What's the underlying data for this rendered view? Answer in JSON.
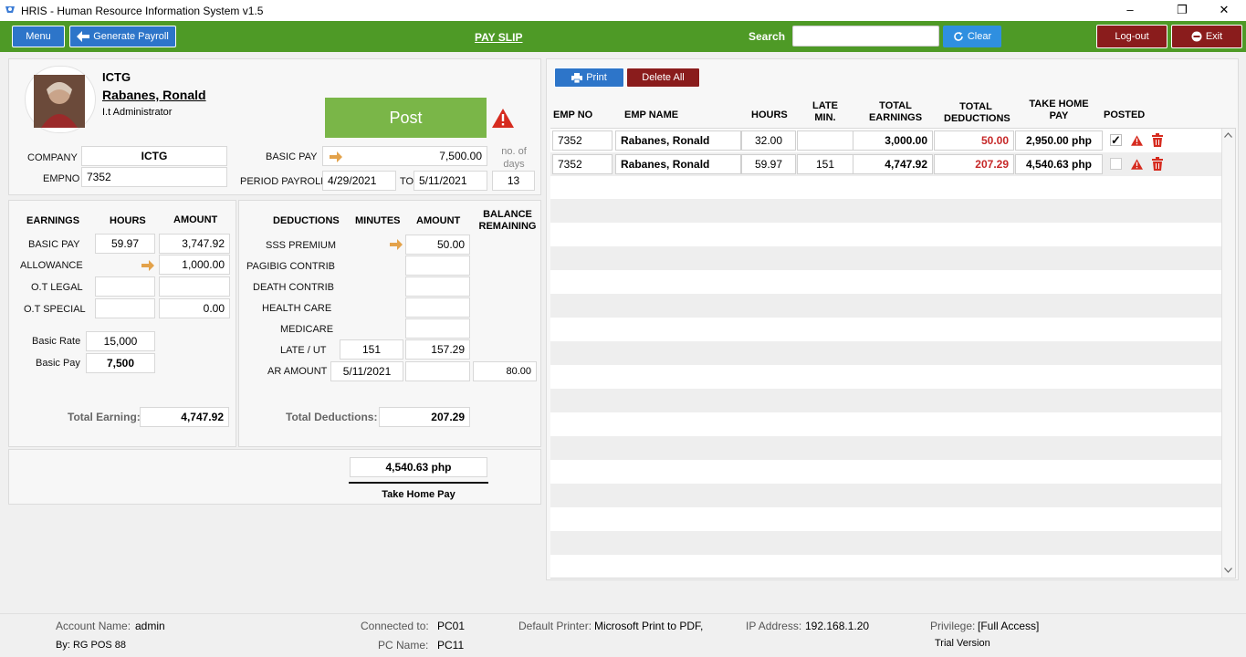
{
  "window": {
    "title": "HRIS - Human Resource Information System v1.5",
    "minimize": "–",
    "restore": "❐",
    "close": "✕"
  },
  "toolbar": {
    "menu": "Menu",
    "generate_payroll": "Generate Payroll",
    "page_title": "PAY SLIP",
    "search_label": "Search",
    "search_value": "",
    "clear": "Clear",
    "logout": "Log-out",
    "exit": "Exit",
    "accent": "#4e9a26"
  },
  "employee": {
    "company_short": "ICTG",
    "name": "Rabanes,  Ronald",
    "position": "I.t Administrator",
    "company_label": "COMPANY",
    "company": "ICTG",
    "empno_label": "EMPNO",
    "empno": "7352",
    "basic_pay_label": "BASIC PAY",
    "basic_pay": "7,500.00",
    "no_days_label": "no. of days",
    "period_label": "PERIOD PAYROLL",
    "period_from": "4/29/2021",
    "to_label": "TO",
    "period_to": "5/11/2021",
    "no_days": "13",
    "post": "Post"
  },
  "earnings": {
    "h_earnings": "EARNINGS",
    "h_hours": "HOURS",
    "h_amount": "AMOUNT",
    "rows": [
      {
        "label": "BASIC PAY",
        "hours": "59.97",
        "amount": "3,747.92"
      },
      {
        "label": "ALLOWANCE",
        "hours": "",
        "amount": "1,000.00"
      },
      {
        "label": "O.T LEGAL",
        "hours": "",
        "amount": ""
      },
      {
        "label": "O.T SPECIAL",
        "hours": "",
        "amount": "0.00"
      }
    ],
    "basic_rate_label": "Basic Rate",
    "basic_rate": "15,000",
    "basic_pay_label": "Basic Pay",
    "basic_pay": "7,500",
    "total_label": "Total Earning:",
    "total": "4,747.92"
  },
  "deductions": {
    "h_deductions": "DEDUCTIONS",
    "h_minutes": "MINUTES",
    "h_amount": "AMOUNT",
    "h_balance": "BALANCE REMAINING",
    "rows": [
      {
        "label": "SSS PREMIUM",
        "minutes": "",
        "amount": "50.00",
        "balance": ""
      },
      {
        "label": "PAGIBIG CONTRIB",
        "minutes": "",
        "amount": "",
        "balance": ""
      },
      {
        "label": "DEATH CONTRIB",
        "minutes": "",
        "amount": "",
        "balance": ""
      },
      {
        "label": "HEALTH CARE",
        "minutes": "",
        "amount": "",
        "balance": ""
      },
      {
        "label": "MEDICARE",
        "minutes": "",
        "amount": "",
        "balance": ""
      },
      {
        "label": "LATE /  UT",
        "minutes": "151",
        "amount": "157.29",
        "balance": ""
      },
      {
        "label": "AR AMOUNT",
        "minutes": "5/11/2021",
        "amount": "",
        "balance": "80.00"
      }
    ],
    "total_label": "Total Deductions:",
    "total": "207.29"
  },
  "take_home": {
    "value": "4,540.63 php",
    "label": "Take Home Pay"
  },
  "right": {
    "print": "Print",
    "delete_all": "Delete All",
    "headers": {
      "empno": "EMP NO",
      "name": "EMP NAME",
      "hours": "HOURS",
      "late": "LATE MIN.",
      "earn": "TOTAL EARNINGS",
      "ded": "TOTAL DEDUCTIONS",
      "thp": "TAKE HOME PAY",
      "posted": "POSTED"
    },
    "rows": [
      {
        "empno": "7352",
        "name": "Rabanes,  Ronald",
        "hours": "32.00",
        "late": "",
        "earn": "3,000.00",
        "ded": "50.00",
        "thp": "2,950.00 php",
        "posted": true
      },
      {
        "empno": "7352",
        "name": "Rabanes,  Ronald",
        "hours": "59.97",
        "late": "151",
        "earn": "4,747.92",
        "ded": "207.29",
        "thp": "4,540.63 php",
        "posted": false
      }
    ]
  },
  "footer": {
    "account_label": "Account Name:",
    "account": "admin",
    "by": "By: RG POS 88",
    "connected_label": "Connected to:",
    "connected": "PC01",
    "pcname_label": "PC Name:",
    "pcname": "PC11",
    "printer_label": "Default Printer:",
    "printer": "Microsoft Print to PDF,",
    "ip_label": "IP Address:",
    "ip": "192.168.1.20",
    "priv_label": "Privilege:",
    "priv": "[Full Access]",
    "trial": "Trial Version"
  },
  "colors": {
    "blue_button": "#2d75c9",
    "dark_red_button": "#8a1c1c",
    "post_green": "#7ab648",
    "deduction_red": "#c62828",
    "warning_red": "#d62b1f"
  }
}
